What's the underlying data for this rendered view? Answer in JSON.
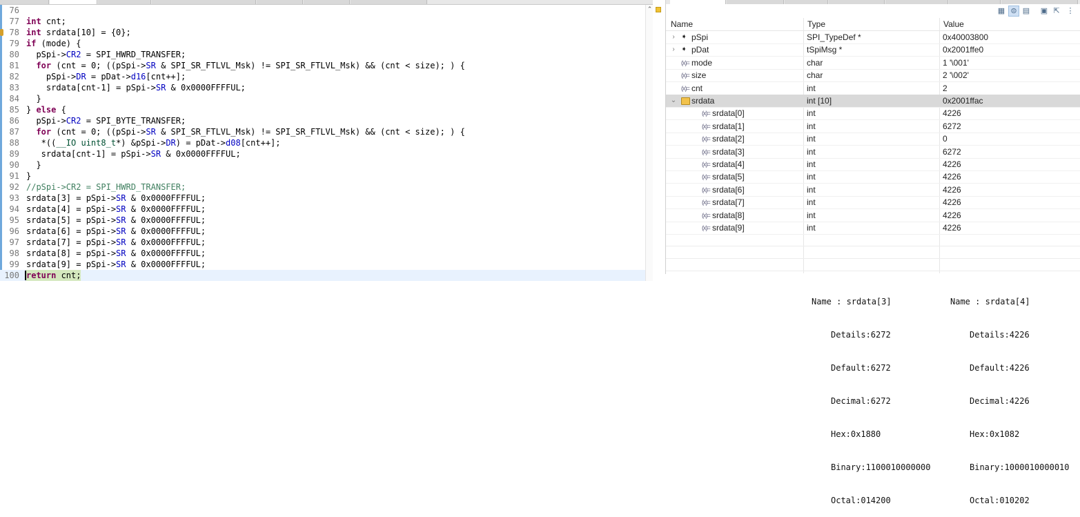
{
  "editor": {
    "lines": [
      {
        "n": "76",
        "html": ""
      },
      {
        "n": "77",
        "html": "<span class=\"k\">int</span> cnt;"
      },
      {
        "n": "78",
        "html": "<span class=\"k\">int</span> srdata[10] = {0};"
      },
      {
        "n": "79",
        "html": "<span class=\"k\">if</span> (mode) {"
      },
      {
        "n": "80",
        "html": "  pSpi-&gt;<span class=\"f\">CR2</span> = SPI_HWRD_TRANSFER;"
      },
      {
        "n": "81",
        "html": "  <span class=\"k\">for</span> (cnt = 0; ((pSpi-&gt;<span class=\"f\">SR</span> &amp; SPI_SR_FTLVL_Msk) != SPI_SR_FTLVL_Msk) &amp;&amp; (cnt &lt; size); ) {"
      },
      {
        "n": "82",
        "html": "    pSpi-&gt;<span class=\"f\">DR</span> = pDat-&gt;<span class=\"f\">d16</span>[cnt++];"
      },
      {
        "n": "83",
        "html": "    srdata[cnt-1] = pSpi-&gt;<span class=\"f\">SR</span> &amp; 0x0000FFFFUL;"
      },
      {
        "n": "84",
        "html": "  }"
      },
      {
        "n": "85",
        "html": "} <span class=\"k\">else</span> {"
      },
      {
        "n": "86",
        "html": "  pSpi-&gt;<span class=\"f\">CR2</span> = SPI_BYTE_TRANSFER;"
      },
      {
        "n": "87",
        "html": "  <span class=\"k\">for</span> (cnt = 0; ((pSpi-&gt;<span class=\"f\">SR</span> &amp; SPI_SR_FTLVL_Msk) != SPI_SR_FTLVL_Msk) &amp;&amp; (cnt &lt; size); ) {"
      },
      {
        "n": "88",
        "html": "   *((<span class=\"m\">__IO uint8_t</span>*) &amp;pSpi-&gt;<span class=\"f\">DR</span>) = pDat-&gt;<span class=\"f\">d08</span>[cnt++];"
      },
      {
        "n": "89",
        "html": "   srdata[cnt-1] = pSpi-&gt;<span class=\"f\">SR</span> &amp; 0x0000FFFFUL;"
      },
      {
        "n": "90",
        "html": "  }"
      },
      {
        "n": "91",
        "html": "}"
      },
      {
        "n": "92",
        "html": "<span class=\"c\">//pSpi-&gt;CR2 = SPI_HWRD_TRANSFER;</span>"
      },
      {
        "n": "93",
        "html": "srdata[3] = pSpi-&gt;<span class=\"f\">SR</span> &amp; 0x0000FFFFUL;"
      },
      {
        "n": "94",
        "html": "srdata[4] = pSpi-&gt;<span class=\"f\">SR</span> &amp; 0x0000FFFFUL;"
      },
      {
        "n": "95",
        "html": "srdata[5] = pSpi-&gt;<span class=\"f\">SR</span> &amp; 0x0000FFFFUL;"
      },
      {
        "n": "96",
        "html": "srdata[6] = pSpi-&gt;<span class=\"f\">SR</span> &amp; 0x0000FFFFUL;"
      },
      {
        "n": "97",
        "html": "srdata[7] = pSpi-&gt;<span class=\"f\">SR</span> &amp; 0x0000FFFFUL;"
      },
      {
        "n": "98",
        "html": "srdata[8] = pSpi-&gt;<span class=\"f\">SR</span> &amp; 0x0000FFFFUL;"
      },
      {
        "n": "99",
        "html": "srdata[9] = pSpi-&gt;<span class=\"f\">SR</span> &amp; 0x0000FFFFUL;"
      },
      {
        "n": "100",
        "html": "<span class=\"k\">return</span> cnt;",
        "current": true
      }
    ]
  },
  "variables": {
    "headers": {
      "name": "Name",
      "type": "Type",
      "value": "Value"
    },
    "rows": [
      {
        "name": "pSpi",
        "type": "SPI_TypeDef *",
        "value": "0x40003800",
        "kind": "pointer",
        "expander": "collapsed"
      },
      {
        "name": "pDat",
        "type": "tSpiMsg *",
        "value": "0x2001ffe0",
        "kind": "pointer",
        "expander": "collapsed"
      },
      {
        "name": "mode",
        "type": "char",
        "value": "1 '\\001'",
        "kind": "var"
      },
      {
        "name": "size",
        "type": "char",
        "value": "2 '\\002'",
        "kind": "var"
      },
      {
        "name": "cnt",
        "type": "int",
        "value": "2",
        "kind": "var"
      },
      {
        "name": "srdata",
        "type": "int [10]",
        "value": "0x2001ffac",
        "kind": "array",
        "expander": "expanded",
        "selected": true
      },
      {
        "name": "srdata[0]",
        "type": "int",
        "value": "4226",
        "kind": "var",
        "child": true
      },
      {
        "name": "srdata[1]",
        "type": "int",
        "value": "6272",
        "kind": "var",
        "child": true
      },
      {
        "name": "srdata[2]",
        "type": "int",
        "value": "0",
        "kind": "var",
        "child": true
      },
      {
        "name": "srdata[3]",
        "type": "int",
        "value": "6272",
        "kind": "var",
        "child": true
      },
      {
        "name": "srdata[4]",
        "type": "int",
        "value": "4226",
        "kind": "var",
        "child": true
      },
      {
        "name": "srdata[5]",
        "type": "int",
        "value": "4226",
        "kind": "var",
        "child": true
      },
      {
        "name": "srdata[6]",
        "type": "int",
        "value": "4226",
        "kind": "var",
        "child": true
      },
      {
        "name": "srdata[7]",
        "type": "int",
        "value": "4226",
        "kind": "var",
        "child": true
      },
      {
        "name": "srdata[8]",
        "type": "int",
        "value": "4226",
        "kind": "var",
        "child": true
      },
      {
        "name": "srdata[9]",
        "type": "int",
        "value": "4226",
        "kind": "var",
        "child": true
      }
    ]
  },
  "details": [
    {
      "name": "Name : srdata[3]",
      "details": "Details:6272",
      "default": "Default:6272",
      "decimal": "Decimal:6272",
      "hex": "Hex:0x1880",
      "binary": "Binary:1100010000000",
      "octal": "Octal:014200"
    },
    {
      "name": "Name : srdata[4]",
      "details": "Details:4226",
      "default": "Default:4226",
      "decimal": "Decimal:4226",
      "hex": "Hex:0x1082",
      "binary": "Binary:1000010000010",
      "octal": "Octal:010202"
    }
  ]
}
